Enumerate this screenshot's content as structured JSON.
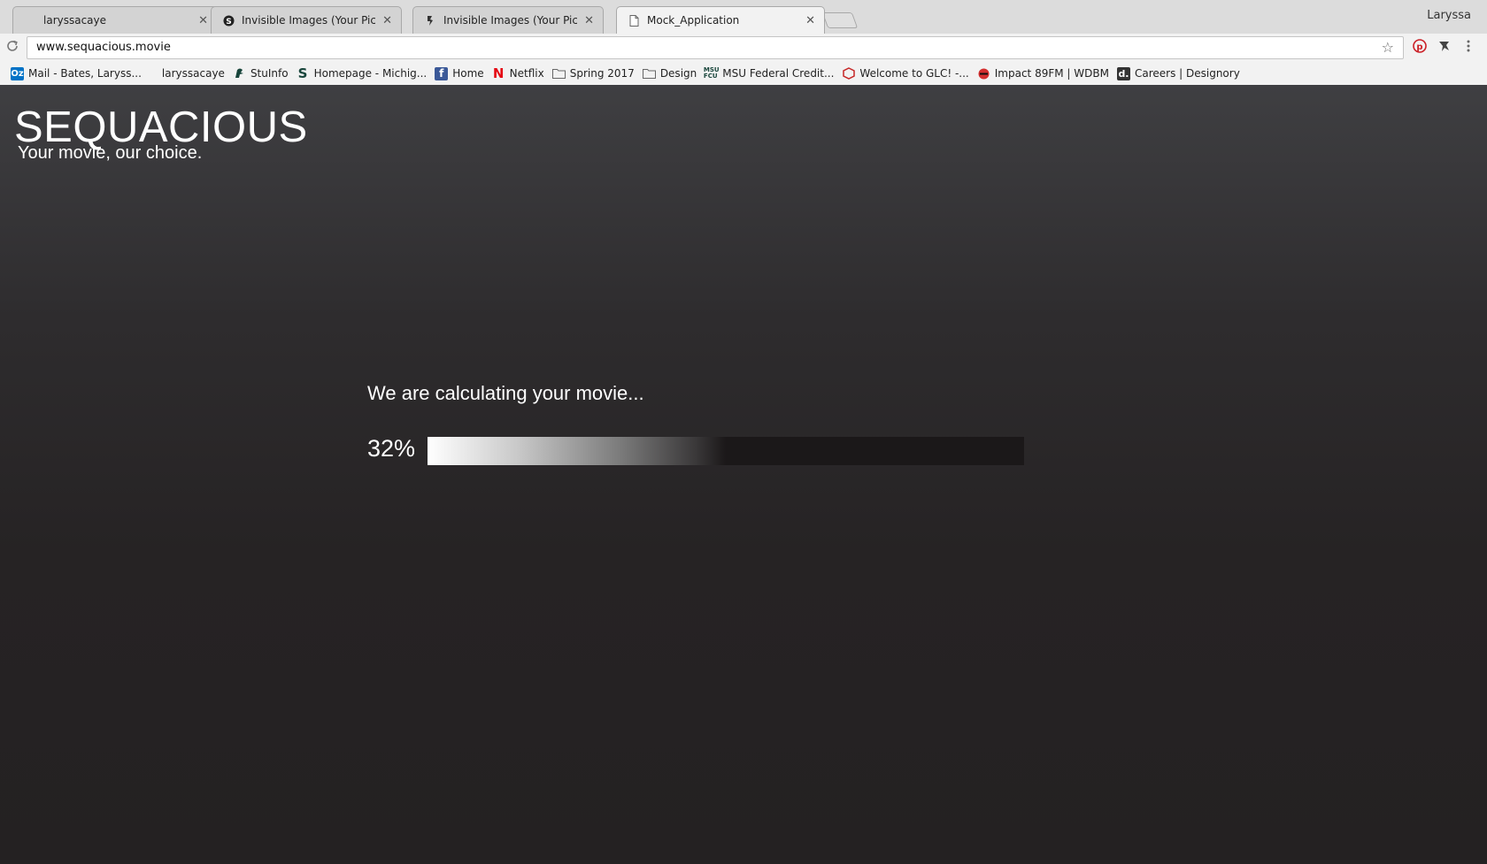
{
  "browser": {
    "tabs": [
      {
        "title": "laryssacaye",
        "icon": "blank-icon"
      },
      {
        "title": "Invisible Images (Your Pictures",
        "icon": "s-circle-icon"
      },
      {
        "title": "Invisible Images (Your Pictures",
        "icon": "figure-icon"
      },
      {
        "title": "Mock_Application",
        "icon": "page-icon",
        "active": true
      }
    ],
    "profile": "Laryssa",
    "url": "www.sequacious.movie",
    "bookmarks": [
      {
        "label": "Mail - Bates, Laryss...",
        "icon": "outlook-icon",
        "color": "#0072c6"
      },
      {
        "label": "laryssacaye",
        "icon": "blank-icon"
      },
      {
        "label": "StuInfo",
        "icon": "spartan-icon",
        "color": "#18453b"
      },
      {
        "label": "Homepage - Michig...",
        "icon": "msu-s-icon",
        "color": "#18453b"
      },
      {
        "label": "Home",
        "icon": "facebook-icon",
        "color": "#3b5998"
      },
      {
        "label": "Netflix",
        "icon": "netflix-icon",
        "color": "#e50914"
      },
      {
        "label": "Spring 2017",
        "icon": "folder-icon"
      },
      {
        "label": "Design",
        "icon": "folder-icon"
      },
      {
        "label": "MSU Federal Credit...",
        "icon": "msufcu-icon",
        "color": "#18453b"
      },
      {
        "label": "Welcome to GLC! -...",
        "icon": "glc-icon",
        "color": "#c62828"
      },
      {
        "label": "Impact 89FM | WDBM",
        "icon": "impact-icon",
        "color": "#d32f2f"
      },
      {
        "label": "Careers | Designory",
        "icon": "designory-icon",
        "color": "#333333"
      }
    ]
  },
  "app": {
    "title": "SEQUACIOUS",
    "tagline": "Your movie, our choice.",
    "message": "We are calculating your movie...",
    "progress_label": "32%",
    "progress_value": 0.5
  }
}
